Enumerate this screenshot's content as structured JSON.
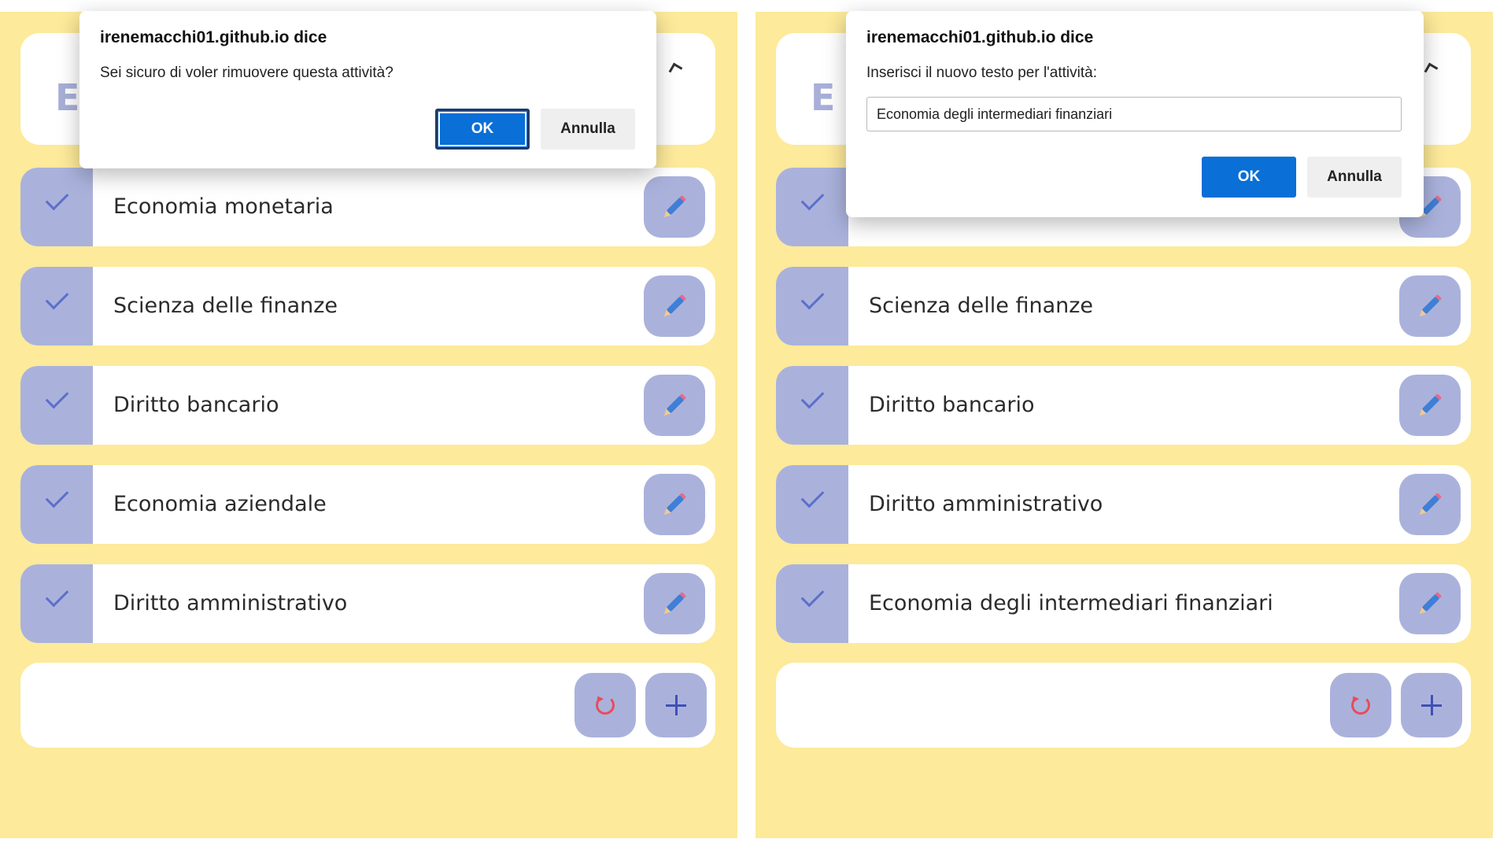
{
  "colors": {
    "background": "#fdea9a",
    "card": "#ffffff",
    "accent": "#aab2dc",
    "check": "#5c6fc9",
    "ok_button": "#0a6fd6",
    "reset_icon": "#e84c5a",
    "plus_icon": "#4050b5"
  },
  "left_panel": {
    "header_letter": "E",
    "tasks": [
      {
        "text": "Economia monetaria",
        "icon": "check-icon",
        "edit_icon": "pencil-icon"
      },
      {
        "text": "Scienza delle finanze",
        "icon": "check-icon",
        "edit_icon": "pencil-icon"
      },
      {
        "text": "Diritto bancario",
        "icon": "check-icon",
        "edit_icon": "pencil-icon"
      },
      {
        "text": "Economia aziendale",
        "icon": "check-icon",
        "edit_icon": "pencil-icon"
      },
      {
        "text": "Diritto amministrativo",
        "icon": "check-icon",
        "edit_icon": "pencil-icon"
      }
    ],
    "footer_icons": [
      "reset-icon",
      "plus-icon"
    ],
    "dialog": {
      "title": "irenemacchi01.github.io dice",
      "message": "Sei sicuro di voler rimuovere questa attività?",
      "ok_label": "OK",
      "cancel_label": "Annulla"
    }
  },
  "right_panel": {
    "header_letter": "E",
    "tasks": [
      {
        "text": "",
        "icon": "check-icon",
        "edit_icon": "pencil-icon"
      },
      {
        "text": "Scienza delle finanze",
        "icon": "check-icon",
        "edit_icon": "pencil-icon"
      },
      {
        "text": "Diritto bancario",
        "icon": "check-icon",
        "edit_icon": "pencil-icon"
      },
      {
        "text": "Diritto amministrativo",
        "icon": "check-icon",
        "edit_icon": "pencil-icon"
      },
      {
        "text": "Economia degli intermediari finanziari",
        "icon": "check-icon",
        "edit_icon": "pencil-icon"
      }
    ],
    "footer_icons": [
      "reset-icon",
      "plus-icon"
    ],
    "dialog": {
      "title": "irenemacchi01.github.io dice",
      "message": "Inserisci il nuovo testo per l'attività:",
      "input_value": "Economia degli intermediari finanziari",
      "ok_label": "OK",
      "cancel_label": "Annulla"
    }
  }
}
